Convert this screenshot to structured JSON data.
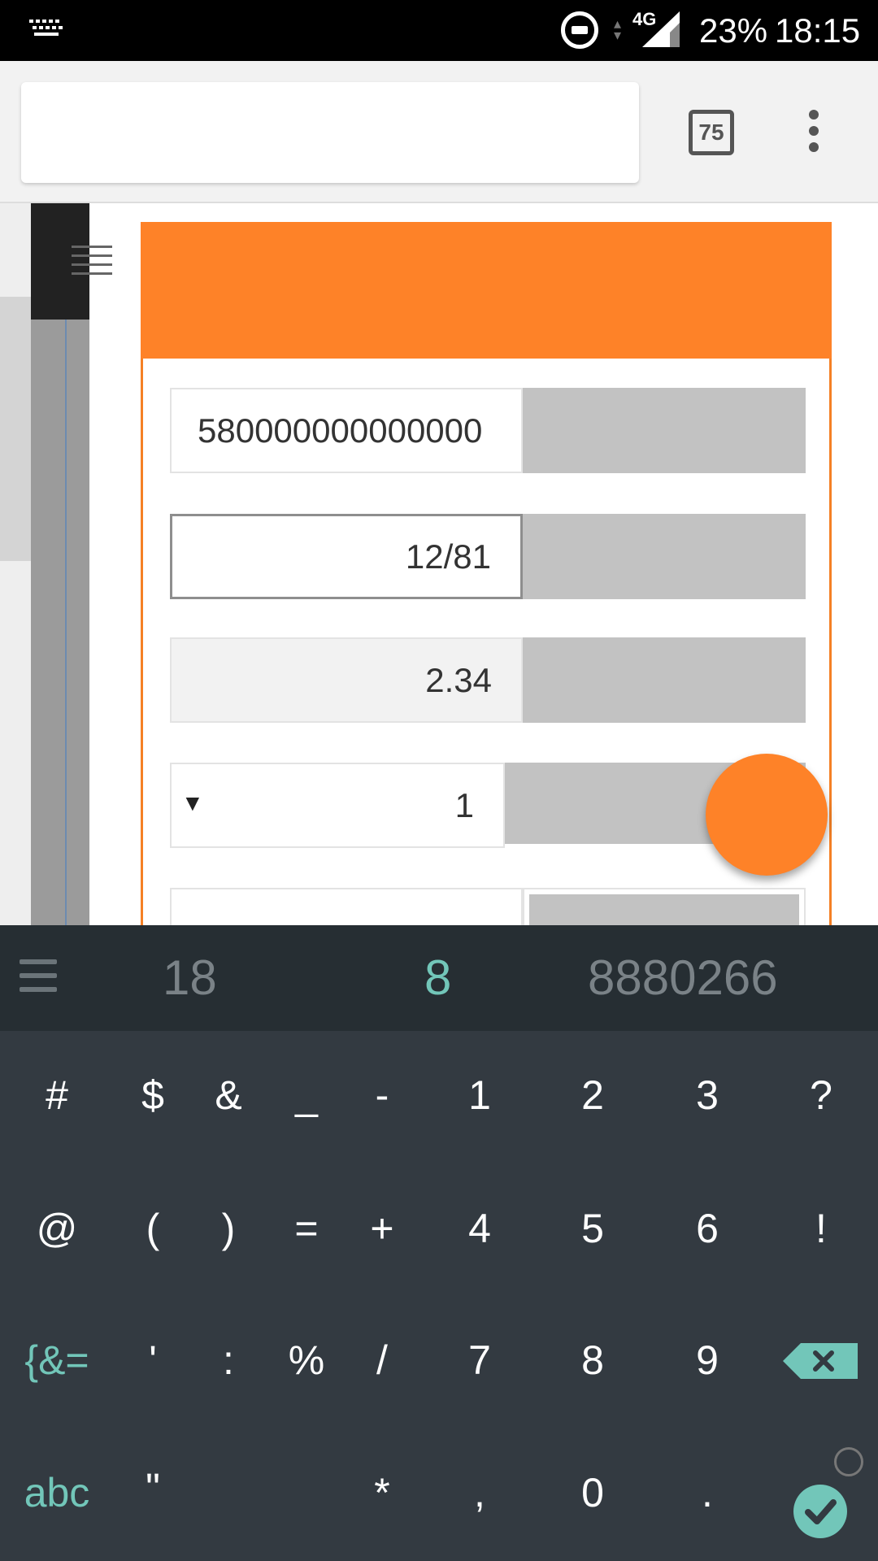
{
  "status_bar": {
    "network": "4G",
    "battery": "23%",
    "time": "18:15"
  },
  "browser": {
    "tab_count": "75"
  },
  "form": {
    "rows": [
      {
        "value": "580000000000000"
      },
      {
        "value": "12/81"
      },
      {
        "value": "2.34"
      },
      {
        "value": "1",
        "caret": "▼"
      }
    ]
  },
  "keyboard": {
    "suggestions": [
      "18",
      "8",
      "8880266"
    ],
    "keys": {
      "r1": [
        "#",
        "$",
        "&",
        "_",
        "-",
        "1",
        "2",
        "3",
        "?"
      ],
      "r2": [
        "@",
        "(",
        ")",
        "=",
        "+",
        "4",
        "5",
        "6",
        "!"
      ],
      "r3": [
        "{&=",
        "'",
        ":",
        "%",
        "/",
        "7",
        "8",
        "9"
      ],
      "r4": [
        "abc",
        "\"",
        "*",
        ",",
        "0",
        "."
      ]
    }
  },
  "colors": {
    "accent_orange": "#fe8228",
    "keyboard_bg": "#333a41",
    "keyboard_accent": "#72c6b9"
  }
}
